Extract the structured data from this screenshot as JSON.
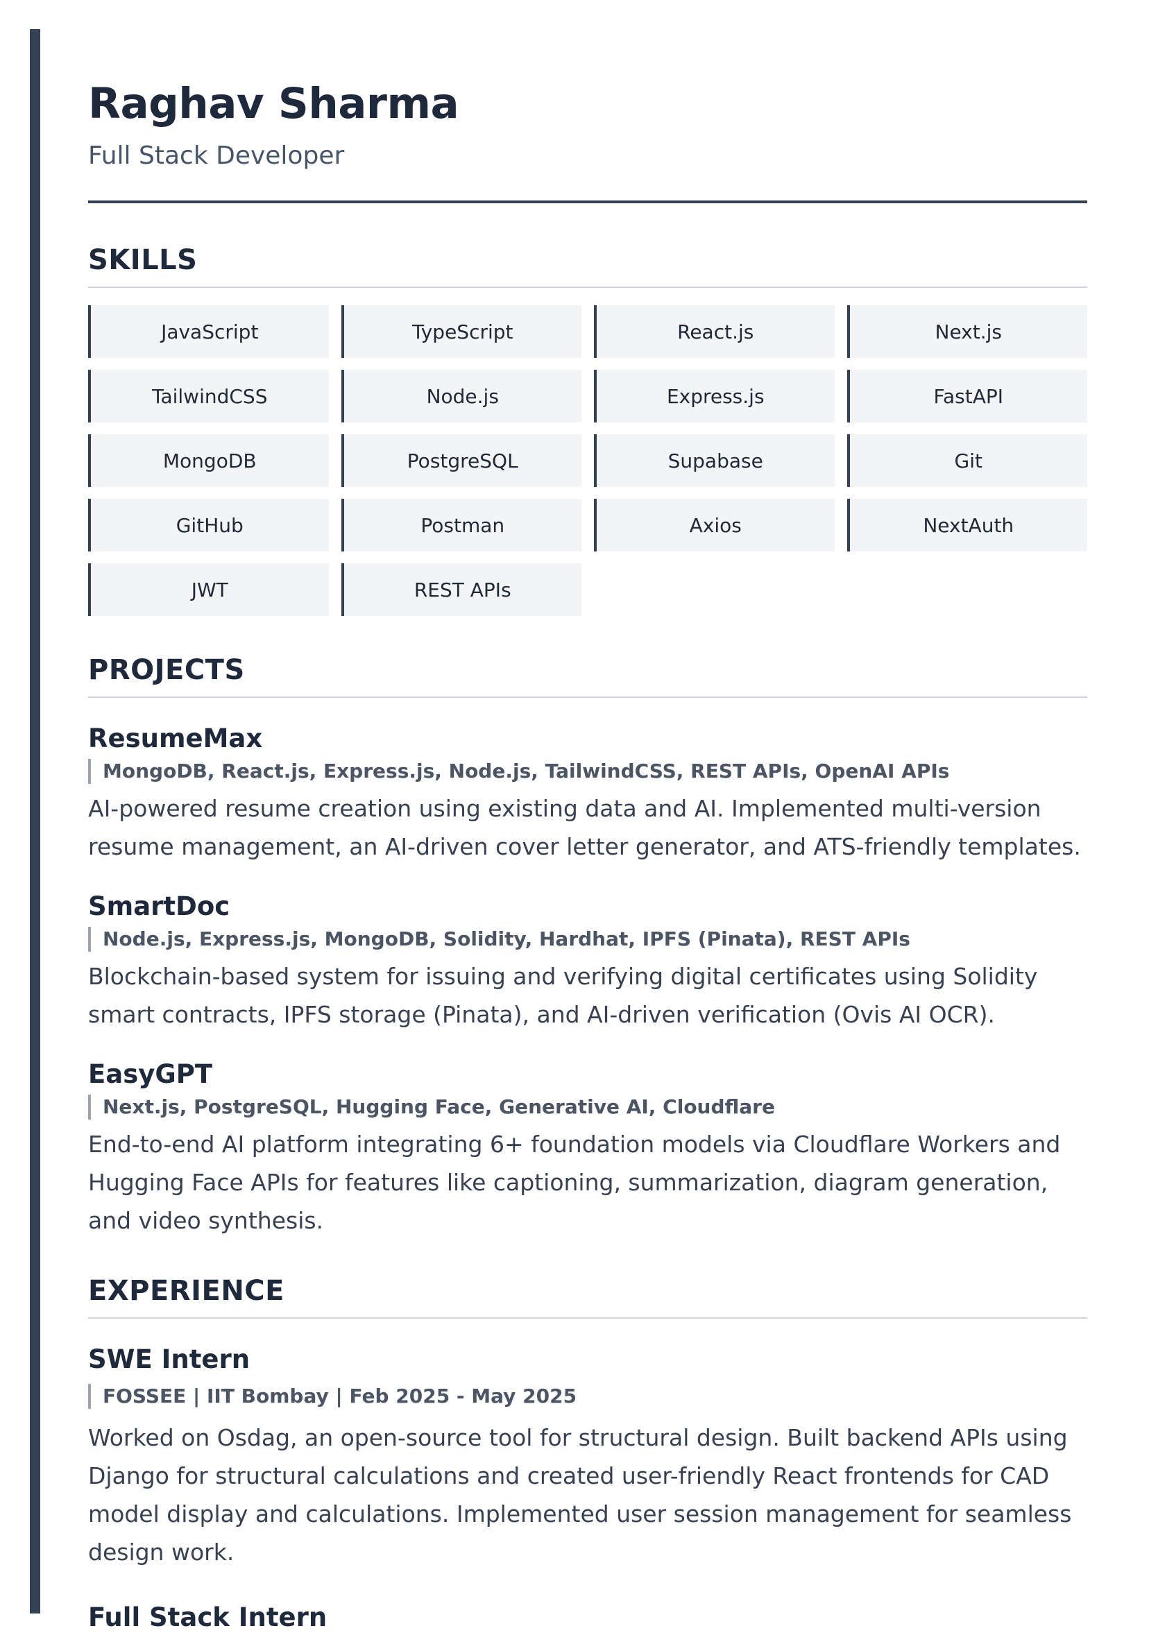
{
  "header": {
    "name": "Raghav Sharma",
    "role": "Full Stack Developer"
  },
  "skills": {
    "title": "SKILLS",
    "items": [
      "JavaScript",
      "TypeScript",
      "React.js",
      "Next.js",
      "TailwindCSS",
      "Node.js",
      "Express.js",
      "FastAPI",
      "MongoDB",
      "PostgreSQL",
      "Supabase",
      "Git",
      "GitHub",
      "Postman",
      "Axios",
      "NextAuth",
      "JWT",
      "REST APIs"
    ]
  },
  "projects": {
    "title": "PROJECTS",
    "items": [
      {
        "name": "ResumeMax",
        "stack": "MongoDB, React.js, Express.js, Node.js, TailwindCSS, REST APIs, OpenAI APIs",
        "description": "AI-powered resume creation using existing data and AI. Implemented multi-version resume management, an AI-driven cover letter generator, and ATS-friendly templates."
      },
      {
        "name": "SmartDoc",
        "stack": "Node.js, Express.js, MongoDB, Solidity, Hardhat, IPFS (Pinata), REST APIs",
        "description": "Blockchain-based system for issuing and verifying digital certificates using Solidity smart contracts, IPFS storage (Pinata), and AI-driven verification (Ovis AI OCR)."
      },
      {
        "name": "EasyGPT",
        "stack": "Next.js, PostgreSQL, Hugging Face, Generative AI, Cloudflare",
        "description": "End-to-end AI platform integrating 6+ foundation models via Cloudflare Workers and Hugging Face APIs for features like captioning, summarization, diagram generation, and video synthesis."
      }
    ]
  },
  "experience": {
    "title": "EXPERIENCE",
    "items": [
      {
        "role": "SWE Intern",
        "meta": "FOSSEE | IIT Bombay | Feb 2025 - May 2025",
        "description": "Worked on Osdag, an open-source tool for structural design. Built backend APIs using Django for structural calculations and created user-friendly React frontends for CAD model display and calculations. Implemented user session management for seamless design work."
      },
      {
        "role": "Full Stack Intern"
      }
    ]
  },
  "colors": {
    "accent": "#334155",
    "heading": "#1e293b",
    "skill_bg": "#f3f4f6"
  }
}
